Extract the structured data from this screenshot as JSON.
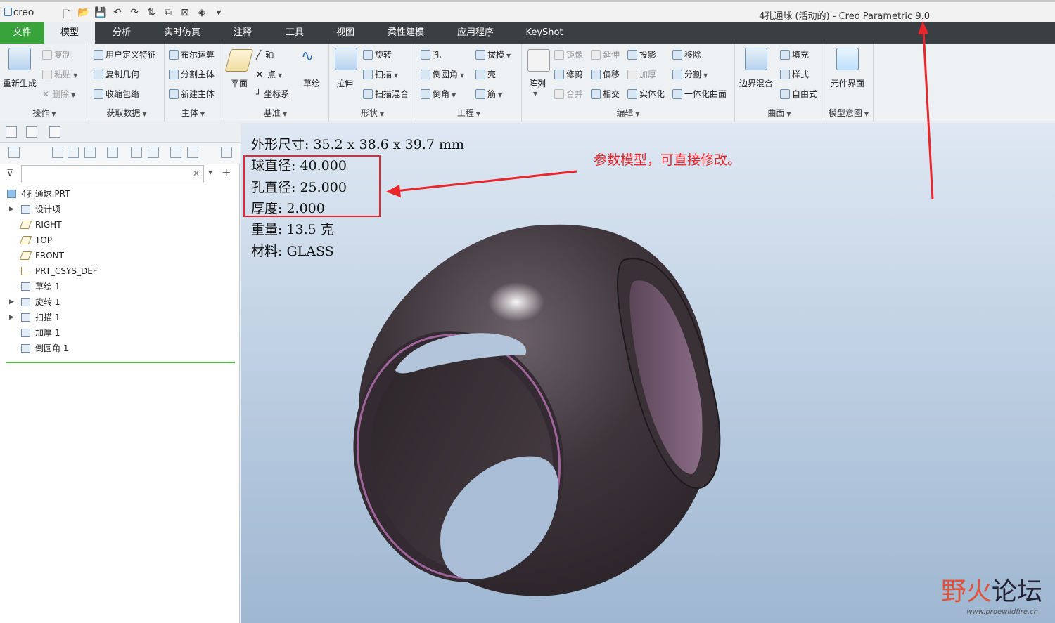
{
  "window": {
    "logo": "creo",
    "title": "4孔通球 (活动的) - Creo Parametric 9.0"
  },
  "tabs": [
    {
      "label": "文件"
    },
    {
      "label": "模型"
    },
    {
      "label": "分析"
    },
    {
      "label": "实时仿真"
    },
    {
      "label": "注释"
    },
    {
      "label": "工具"
    },
    {
      "label": "视图"
    },
    {
      "label": "柔性建模"
    },
    {
      "label": "应用程序"
    },
    {
      "label": "KeyShot"
    }
  ],
  "ribbon": {
    "ops": {
      "label": "操作",
      "regen": "重新生成",
      "copy": "复制",
      "paste": "粘贴",
      "delete": "删除"
    },
    "data": {
      "label": "获取数据",
      "udf": "用户定义特征",
      "copygeom": "复制几何",
      "shrink": "收缩包络"
    },
    "body": {
      "label": "主体",
      "boolean": "布尔运算",
      "split": "分割主体",
      "newbody": "新建主体"
    },
    "datum": {
      "label": "基准",
      "plane": "平面",
      "axis": "轴",
      "point": "点",
      "csys": "坐标系",
      "sketch": "草绘"
    },
    "shapes": {
      "label": "形状",
      "extrude": "拉伸",
      "revolve": "旋转",
      "sweep": "扫描",
      "sweepblend": "扫描混合"
    },
    "eng": {
      "label": "工程",
      "hole": "孔",
      "round": "倒圆角",
      "chamfer": "倒角",
      "draft": "拔模",
      "shell": "壳",
      "rib": "筋"
    },
    "edit": {
      "label": "编辑",
      "pattern": "阵列",
      "mirror": "镜像",
      "extend": "延伸",
      "project": "投影",
      "trim": "修剪",
      "offset": "偏移",
      "thicken": "加厚",
      "merge": "合并",
      "intersect": "相交",
      "solidify": "实体化",
      "remove": "移除",
      "splitsurf": "分割",
      "unify": "一体化曲面"
    },
    "surf": {
      "label": "曲面",
      "boundary": "边界混合",
      "fill": "填充",
      "style": "样式",
      "freestyle": "自由式"
    },
    "intent": {
      "label": "模型意图",
      "compint": "元件界面"
    }
  },
  "tree": {
    "root": "4孔通球.PRT",
    "items": [
      "设计项",
      "RIGHT",
      "TOP",
      "FRONT",
      "PRT_CSYS_DEF",
      "草绘 1",
      "旋转 1",
      "扫描 1",
      "加厚 1",
      "倒圆角 1"
    ]
  },
  "notes": {
    "size": "外形尺寸: 35.2 x 38.6 x 39.7 mm",
    "ball": "球直径: 40.000",
    "hole": "孔直径: 25.000",
    "thick": "厚度: 2.000",
    "weight": "重量: 13.5 克",
    "material": "材料: GLASS"
  },
  "annotation": "参数模型，可直接修改。",
  "watermark": {
    "left": "野火",
    "right": "论坛",
    "url": "www.proewildfire.cn"
  },
  "colors": {
    "highlight": "#e8262b",
    "file_tab": "#37a33a",
    "tab_bar": "#3a3f44",
    "model": "#3a3137"
  }
}
